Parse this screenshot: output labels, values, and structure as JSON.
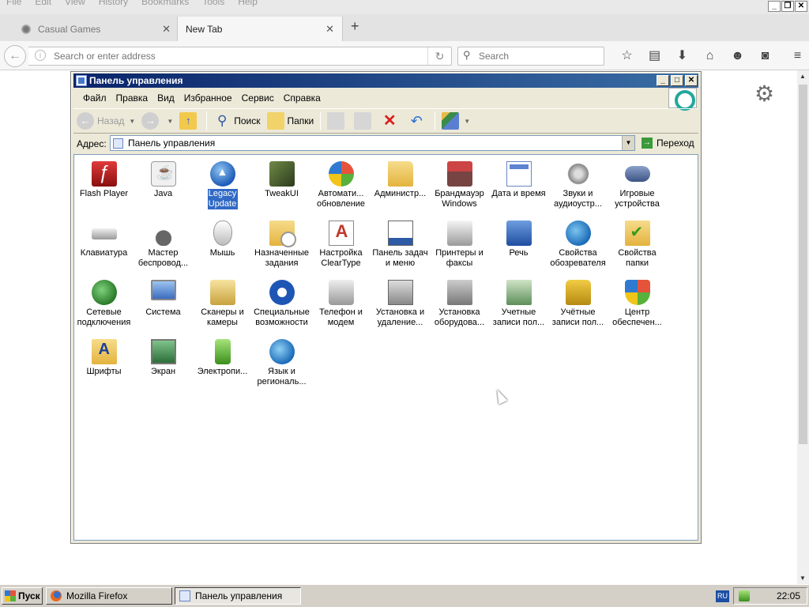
{
  "firefox": {
    "menu": [
      "File",
      "Edit",
      "View",
      "History",
      "Bookmarks",
      "Tools",
      "Help"
    ],
    "tabs": [
      {
        "label": "Casual Games",
        "active": false
      },
      {
        "label": "New Tab",
        "active": true
      }
    ],
    "url_placeholder": "Search or enter address",
    "search_placeholder": "Search"
  },
  "explorer": {
    "title": "Панель управления",
    "menu": [
      "Файл",
      "Правка",
      "Вид",
      "Избранное",
      "Сервис",
      "Справка"
    ],
    "toolbar": {
      "back": "Назад",
      "search": "Поиск",
      "folders": "Папки"
    },
    "address": {
      "label": "Адрес:",
      "value": "Панель управления",
      "go": "Переход"
    },
    "items": [
      {
        "label": "Flash Player",
        "icon": "flash-player-icon"
      },
      {
        "label": "Java",
        "icon": "java-icon"
      },
      {
        "label": "Legacy Update",
        "icon": "legacy-update-icon",
        "selected": true
      },
      {
        "label": "TweakUI",
        "icon": "tweakui-icon"
      },
      {
        "label": "Автомати... обновление",
        "icon": "automatic-updates-icon"
      },
      {
        "label": "Администр...",
        "icon": "administrative-tools-icon"
      },
      {
        "label": "Брандмауэр Windows",
        "icon": "firewall-icon"
      },
      {
        "label": "Дата и время",
        "icon": "date-time-icon"
      },
      {
        "label": "Звуки и аудиоустр...",
        "icon": "sounds-icon"
      },
      {
        "label": "Игровые устройства",
        "icon": "game-controller-icon"
      },
      {
        "label": "Клавиатура",
        "icon": "keyboard-icon"
      },
      {
        "label": "Мастер беспровод...",
        "icon": "wireless-wizard-icon"
      },
      {
        "label": "Мышь",
        "icon": "mouse-icon"
      },
      {
        "label": "Назначенные задания",
        "icon": "scheduled-tasks-icon"
      },
      {
        "label": "Настройка ClearType",
        "icon": "cleartype-icon"
      },
      {
        "label": "Панель задач и меню \"Пуск\"",
        "icon": "taskbar-start-menu-icon"
      },
      {
        "label": "Принтеры и факсы",
        "icon": "printers-icon"
      },
      {
        "label": "Речь",
        "icon": "speech-icon"
      },
      {
        "label": "Свойства обозревателя",
        "icon": "internet-options-icon"
      },
      {
        "label": "Свойства папки",
        "icon": "folder-options-icon"
      },
      {
        "label": "Сетевые подключения",
        "icon": "network-connections-icon"
      },
      {
        "label": "Система",
        "icon": "system-icon"
      },
      {
        "label": "Сканеры и камеры",
        "icon": "scanners-cameras-icon"
      },
      {
        "label": "Специальные возможности",
        "icon": "accessibility-icon"
      },
      {
        "label": "Телефон и модем",
        "icon": "phone-modem-icon"
      },
      {
        "label": "Установка и удаление...",
        "icon": "add-remove-programs-icon"
      },
      {
        "label": "Установка оборудова...",
        "icon": "add-hardware-icon"
      },
      {
        "label": "Учетные записи пол...",
        "icon": "user-accounts-icon"
      },
      {
        "label": "Учётные записи пол...",
        "icon": "user-accounts-lock-icon"
      },
      {
        "label": "Центр обеспечен...",
        "icon": "security-center-icon"
      },
      {
        "label": "Шрифты",
        "icon": "fonts-icon"
      },
      {
        "label": "Экран",
        "icon": "display-icon"
      },
      {
        "label": "Электропи...",
        "icon": "power-options-icon"
      },
      {
        "label": "Язык и региональ...",
        "icon": "regional-options-icon"
      }
    ]
  },
  "taskbar": {
    "start": "Пуск",
    "buttons": [
      "Mozilla Firefox",
      "Панель управления"
    ],
    "lang": "RU",
    "time": "22:05"
  }
}
